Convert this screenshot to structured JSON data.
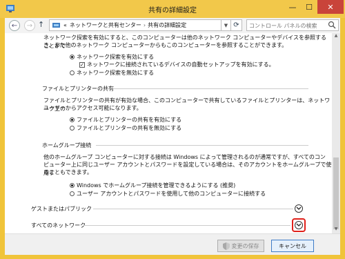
{
  "window": {
    "title": "共有の詳細設定"
  },
  "nav": {
    "breadcrumb": [
      "ネットワークと共有センター",
      "共有の詳細設定"
    ],
    "overflow": "«",
    "separator": "›",
    "search_placeholder": "コントロール パネルの検索"
  },
  "intro": {
    "line1": "ネットワーク探索を有効にすると、このコンピューターは他のネットワーク コンピューターやデバイスを参照することがで",
    "line2": "き、また他のネットワーク コンピューターからもこのコンピューターを参照することができます。"
  },
  "discovery": {
    "on_label": "ネットワーク探索を有効にする",
    "auto_label": "ネットワークに接続されているデバイスの自動セットアップを有効にする。",
    "off_label": "ネットワーク探索を無効にする"
  },
  "file_sharing": {
    "heading": "ファイルとプリンターの共有",
    "line1": "ファイルとプリンターの共有が有効な場合、このコンピューターで共有しているファイルとプリンターは、ネットワーク上の",
    "line2": "ユーザーからアクセス可能になります。",
    "on_label": "ファイルとプリンターの共有を有効にする",
    "off_label": "ファイルとプリンターの共有を無効にする"
  },
  "homegroup": {
    "heading": "ホームグループ接続",
    "line1": "他のホームグループ コンピューターに対する接続は Windows によって管理されるのが通常ですが、すべてのコン",
    "line2": "ピューター上に同じユーザー アカウントとパスワードを設定している場合は、そのアカウントをホームグループで使用す",
    "line3": "ることもできます。",
    "option1": "Windows でホームグループ接続を管理できるようにする (推奨)",
    "option2": "ユーザー アカウントとパスワードを使用して他のコンピューターに接続する"
  },
  "sections": {
    "guest_public": "ゲストまたはパブリック",
    "all_networks": "すべてのネットワーク"
  },
  "buttons": {
    "save": "変更の保存",
    "cancel": "キャンセル"
  },
  "colors": {
    "title_bar": "#f2c84a",
    "close_button": "#c9443a",
    "highlight": "#e0201a"
  },
  "state": {
    "discovery_enabled": true,
    "auto_setup_checked": true,
    "file_sharing_enabled": true,
    "homegroup_windows_managed": true,
    "all_networks_highlighted": true
  }
}
